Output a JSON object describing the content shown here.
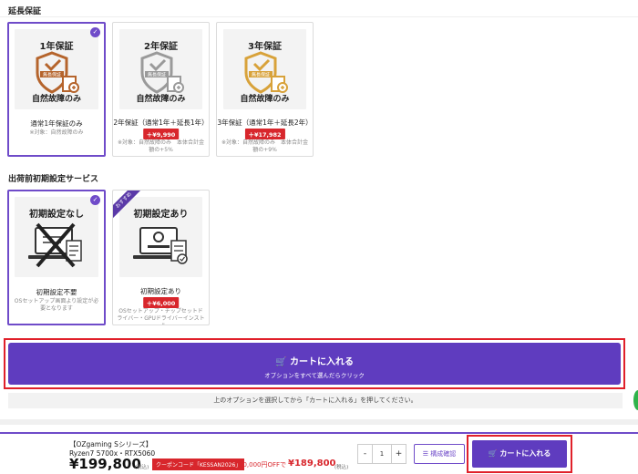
{
  "warranty": {
    "section_title": "延長保証",
    "options": [
      {
        "img_title": "1年保証",
        "img_sub": "自然故障のみ",
        "shield_text": "無長保証",
        "label": "通常1年保証のみ",
        "note": "※対象：自然故障のみ",
        "price": "",
        "selected": true,
        "color": "#b5642c"
      },
      {
        "img_title": "2年保証",
        "img_sub": "自然故障のみ",
        "shield_text": "無長保証",
        "label": "2年保証（通常1年＋延長1年）",
        "note": "※対象：自然故障のみ　本体合計金額の+5%",
        "price": "＋¥9,990",
        "selected": false,
        "color": "#9a9a9a"
      },
      {
        "img_title": "3年保証",
        "img_sub": "自然故障のみ",
        "shield_text": "無長保証",
        "label": "3年保証（通常1年＋延長2年）",
        "note": "※対象：自然故障のみ　本体合計金額の+9%",
        "price": "＋¥17,982",
        "selected": false,
        "color": "#d8a23a"
      }
    ]
  },
  "setup": {
    "section_title": "出荷前初期設定サービス",
    "options": [
      {
        "img_title": "初期設定なし",
        "label": "初期設定不要",
        "note": "OSセットアップ画面より設定が必要となります",
        "price": "",
        "selected": true,
        "ribbon": ""
      },
      {
        "img_title": "初期設定あり",
        "label": "初期設定あり",
        "note": "OSセットアップ・チップセットドライバー・GPUドライバーインストール",
        "price": "＋¥6,000",
        "selected": false,
        "ribbon": "おすすめ"
      }
    ]
  },
  "big_cart": {
    "label": "カートに入れる",
    "sub": "オプションをすべて選んだらクリック"
  },
  "notice": "上のオプションを選択してから「カートに入れる」を押してください。",
  "footer": {
    "series": "【OZgaming Sシリーズ】",
    "spec": "Ryzen7 5700x・RTX5060",
    "price": "¥199,800",
    "tax": "(税込)",
    "coupon": "クーポンコード「KESSAN2026」",
    "coupon_off": "10,000円OFFで",
    "sale_price": "¥189,800",
    "tax2": "(税込)",
    "qty_minus": "-",
    "qty_value": "1",
    "qty_plus": "+",
    "config_label": "構成確認",
    "cart_label": "カートに入れる"
  },
  "colors": {
    "accent": "#6f4bc9",
    "cart": "#5f3cbf",
    "red": "#d8262c"
  }
}
